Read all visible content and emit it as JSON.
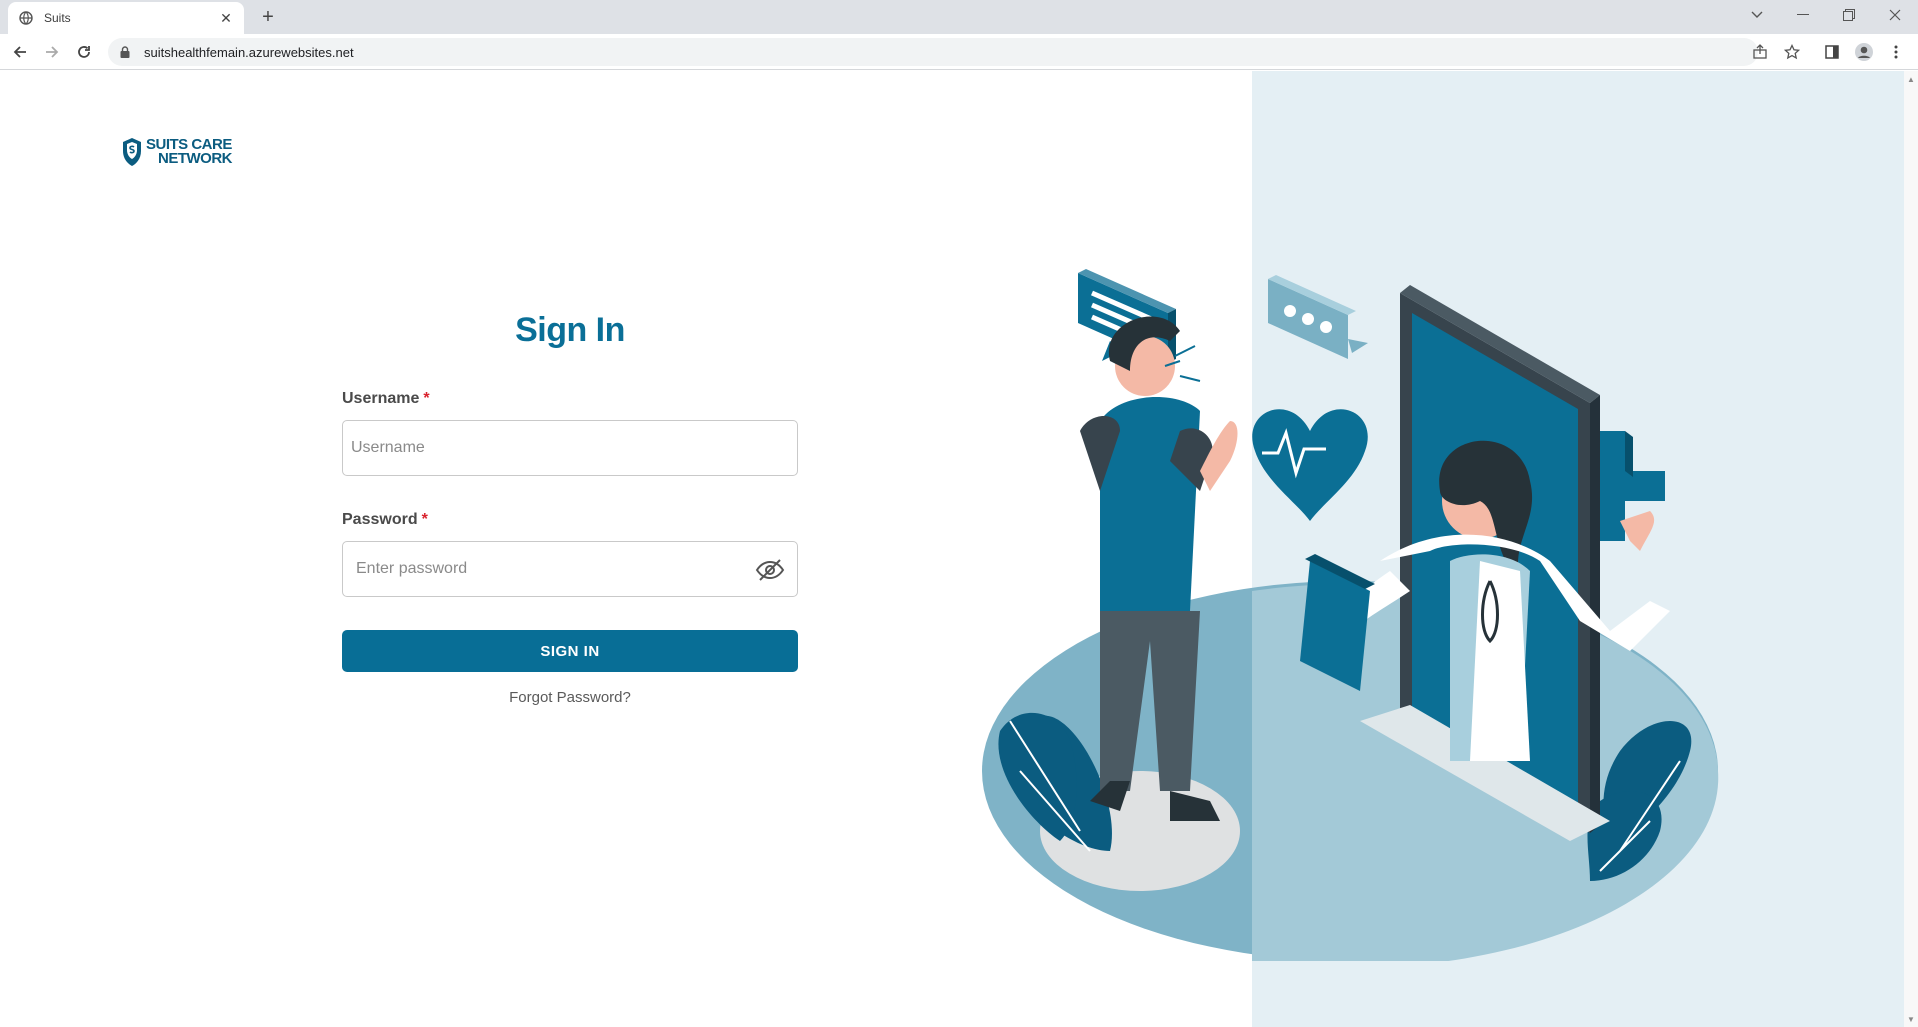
{
  "browser": {
    "tab_title": "Suits",
    "url": "suitshealthfemain.azurewebsites.net"
  },
  "logo": {
    "line1": "SUITS CARE",
    "line2": "NETWORK"
  },
  "form": {
    "heading": "Sign In",
    "username_label": "Username",
    "username_required": "*",
    "username_placeholder": "Username",
    "password_label": "Password",
    "password_required": "*",
    "password_placeholder": "Enter password",
    "submit_label": "SIGN IN",
    "forgot_label": "Forgot Password?"
  },
  "colors": {
    "brand": "#0a6f97",
    "button": "#086e96",
    "required": "#d9232e",
    "illustration_bg": "#e4eff4"
  }
}
